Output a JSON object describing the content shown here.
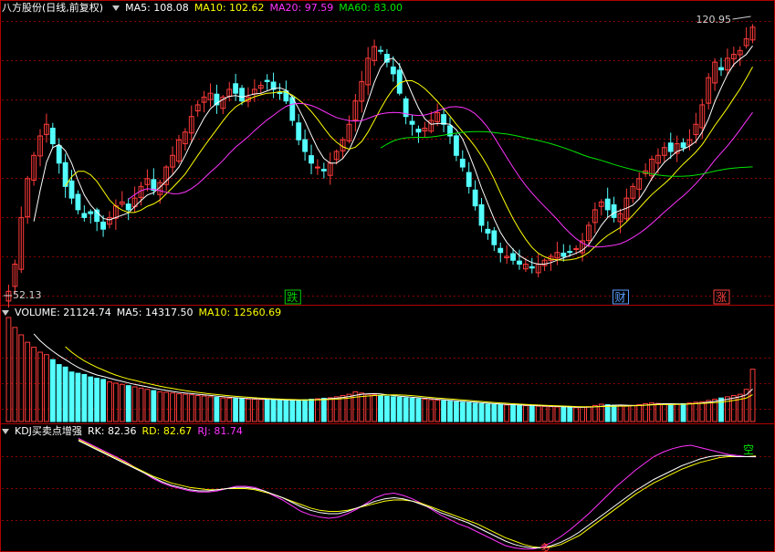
{
  "main": {
    "stock_name": "八方股份",
    "period": "(日线,前复权)",
    "indicators": [
      {
        "label": "MA5: 108.08",
        "color": "#ffffff"
      },
      {
        "label": "MA10: 102.62",
        "color": "#ffff00"
      },
      {
        "label": "MA20: 97.59",
        "color": "#ff33ff"
      },
      {
        "label": "MA60: 83.00",
        "color": "#00e600"
      }
    ],
    "high_label": "120.95",
    "low_label": "52.13",
    "markers": [
      {
        "text": "跌",
        "color": "#00d000",
        "idx": 45
      },
      {
        "text": "财",
        "color": "#5aa0ff",
        "idx": 97
      },
      {
        "text": "涨",
        "color": "#ff4040",
        "idx": 113
      }
    ]
  },
  "volume": {
    "indicators": [
      {
        "label": "VOLUME: 21124.74",
        "color": "#ffffff"
      },
      {
        "label": "MA5: 14317.50",
        "color": "#ffffff"
      },
      {
        "label": "MA10: 12560.69",
        "color": "#ffff00"
      }
    ]
  },
  "kdj": {
    "indicators": [
      {
        "label": "KDJ买卖点增强",
        "color": "#ffffff"
      },
      {
        "label": "RK: 82.36",
        "color": "#ffffff"
      },
      {
        "label": "RD: 82.67",
        "color": "#ffff00"
      },
      {
        "label": "RJ: 81.74",
        "color": "#ff33ff"
      }
    ],
    "signal_top": "空",
    "signal_bottom": "多"
  },
  "colors": {
    "up": "#ff3b3b",
    "down": "#54ffff",
    "grid": "#8a0000",
    "border": "#b00000"
  },
  "chart_data": {
    "type": "candlestick",
    "price_range": [
      52.13,
      120.95
    ],
    "closes": [
      53,
      60,
      72,
      82,
      88,
      93,
      96,
      91,
      86,
      80,
      77,
      74,
      72,
      73,
      71,
      69,
      72,
      75,
      76,
      74,
      77,
      80,
      82,
      79,
      81,
      85,
      88,
      92,
      94,
      98,
      101,
      103,
      104,
      101,
      103,
      105,
      104,
      102,
      103,
      105,
      106,
      107,
      105,
      104,
      102,
      97,
      92,
      89,
      86,
      85,
      84,
      86,
      89,
      92,
      96,
      102,
      107,
      113,
      116,
      115,
      112,
      109,
      104,
      98,
      96,
      94,
      95,
      97,
      99,
      96,
      93,
      88,
      85,
      80,
      75,
      70,
      68,
      65,
      63,
      62,
      61,
      60,
      60,
      59,
      60,
      61,
      62,
      63,
      62,
      63,
      64,
      66,
      70,
      74,
      76,
      74,
      72,
      73,
      77,
      80,
      82,
      84,
      87,
      88,
      90,
      89,
      91,
      90,
      92,
      96,
      101,
      108,
      112,
      110,
      113,
      114,
      115,
      118,
      121
    ],
    "volume_range": [
      0,
      42000
    ],
    "volumes": [
      42000,
      38000,
      35000,
      32000,
      30000,
      28000,
      27000,
      25000,
      23000,
      22000,
      20000,
      19500,
      19000,
      18000,
      17500,
      17000,
      16000,
      15500,
      15000,
      14500,
      14000,
      13500,
      13000,
      12500,
      12000,
      11800,
      11500,
      11200,
      11000,
      10800,
      10500,
      10300,
      10000,
      9800,
      9500,
      9400,
      9300,
      9200,
      9100,
      9000,
      8900,
      8800,
      8700,
      8600,
      8500,
      8600,
      8700,
      8800,
      9000,
      9200,
      9400,
      9600,
      10000,
      10500,
      11000,
      12000,
      11500,
      11000,
      10800,
      10500,
      10200,
      10000,
      9800,
      9600,
      9400,
      9200,
      9000,
      8800,
      8600,
      8400,
      8200,
      8000,
      7800,
      7600,
      7400,
      7200,
      7000,
      6900,
      6800,
      6700,
      6600,
      6500,
      6400,
      6300,
      6200,
      6100,
      6000,
      5900,
      5800,
      5700,
      5600,
      5800,
      6000,
      6500,
      7000,
      6800,
      6600,
      6400,
      6200,
      6500,
      6800,
      7200,
      7500,
      7300,
      7100,
      6900,
      7000,
      7200,
      7500,
      7800,
      8000,
      8500,
      9000,
      9500,
      10000,
      10500,
      11000,
      13000,
      21124.74
    ],
    "kdj_range": [
      0,
      100
    ],
    "kdj_k": [
      96,
      92,
      88,
      84,
      80,
      76,
      72,
      68,
      64,
      60,
      57,
      55,
      53,
      52,
      52,
      53,
      54,
      55,
      55,
      54,
      52,
      49,
      46,
      42,
      38,
      35,
      33,
      32,
      32,
      34,
      37,
      40,
      43,
      45,
      46,
      45,
      43,
      40,
      37,
      33,
      30,
      27,
      24,
      20,
      16,
      12,
      8,
      5,
      3,
      2,
      2,
      4,
      7,
      11,
      16,
      22,
      28,
      34,
      40,
      46,
      52,
      57,
      62,
      66,
      70,
      74,
      77,
      80,
      82,
      83,
      83,
      82,
      82,
      82
    ],
    "kdj_d": [
      97,
      93,
      89,
      85,
      81,
      77,
      73,
      69,
      65,
      62,
      59,
      57,
      55,
      54,
      53,
      53,
      54,
      54,
      54,
      53,
      51,
      49,
      46,
      43,
      40,
      37,
      35,
      34,
      34,
      35,
      37,
      39,
      41,
      43,
      44,
      44,
      43,
      41,
      38,
      35,
      32,
      29,
      26,
      23,
      19,
      15,
      11,
      8,
      5,
      3,
      2,
      3,
      5,
      9,
      13,
      19,
      25,
      31,
      37,
      43,
      49,
      54,
      59,
      63,
      67,
      71,
      74,
      77,
      79,
      81,
      82,
      82,
      82,
      82.67
    ],
    "kdj_j": [
      98,
      94,
      90,
      86,
      82,
      78,
      73,
      68,
      63,
      59,
      56,
      54,
      52,
      51,
      51,
      52,
      54,
      56,
      56,
      55,
      52,
      48,
      44,
      39,
      34,
      31,
      29,
      28,
      29,
      32,
      36,
      41,
      46,
      49,
      50,
      48,
      45,
      41,
      36,
      31,
      27,
      23,
      20,
      16,
      12,
      8,
      4,
      2,
      1,
      1,
      3,
      7,
      12,
      18,
      25,
      32,
      40,
      48,
      56,
      63,
      70,
      76,
      82,
      86,
      89,
      91,
      92,
      90,
      88,
      86,
      84,
      83,
      82,
      81.74
    ]
  }
}
